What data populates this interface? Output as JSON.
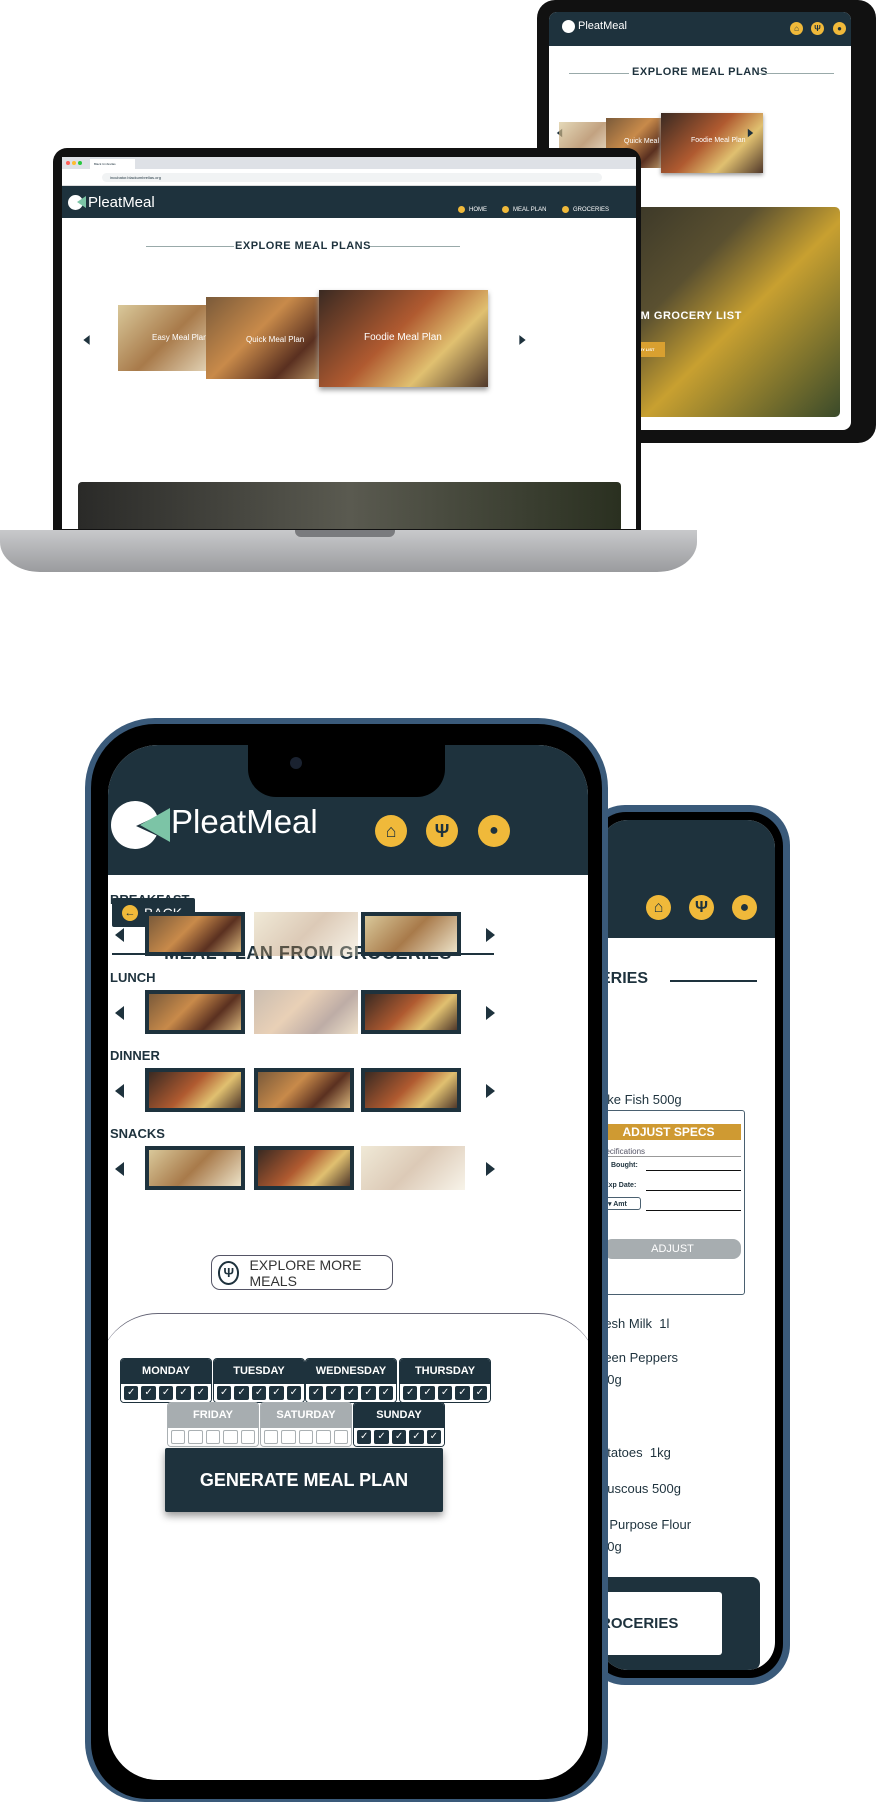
{
  "brand": "PleatMeal",
  "colors": {
    "dark": "#1e323d",
    "gold": "#f0b93a",
    "mint": "#7cc4a6"
  },
  "browser": {
    "tab": "Black Umbrellas",
    "url": "incubator.blackumbrellas.org"
  },
  "laptop": {
    "nav": [
      "HOME",
      "MEAL PLAN",
      "GROCERIES"
    ],
    "title": "EXPLORE MEAL PLANS",
    "plans": [
      "Easy Meal Plan",
      "Quick Meal Plan",
      "Foodie Meal Plan"
    ]
  },
  "tablet": {
    "title": "EXPLORE MEAL PLANS",
    "plans": [
      "Easy Meal Plan",
      "Quick Meal Plan",
      "Foodie Meal Plan"
    ],
    "banner": "E MEALS FROM GROCERY LIST",
    "banner_button": "EXPLORE FROM GROCERY LIST"
  },
  "phone_back": {
    "title_partial": "ERIES",
    "items": [
      "ake Fish 500g",
      "resh Milk  1l",
      "reen Peppers",
      "00g",
      "otatoes  1kg",
      "ouscous 500g",
      "ll Purpose Flour",
      "50g"
    ],
    "popup": {
      "title": "ADJUST SPECS",
      "subtitle": "pecifications",
      "fields": [
        "Bought:",
        "Exp Date:",
        "Amt"
      ],
      "button": "ADJUST"
    },
    "bottom_button": "ROCERIES"
  },
  "phone": {
    "back": "BACK",
    "title": "MEAL PLAN FROM GROCERIES",
    "sections": [
      "BREAKFAST",
      "LUNCH",
      "DINNER",
      "SNACKS"
    ],
    "explore_more": "EXPLORE MORE MEALS",
    "days": [
      {
        "name": "MONDAY",
        "checked": 5
      },
      {
        "name": "TUESDAY",
        "checked": 5
      },
      {
        "name": "WEDNESDAY",
        "checked": 5
      },
      {
        "name": "THURSDAY",
        "checked": 5
      },
      {
        "name": "FRIDAY",
        "checked": 0
      },
      {
        "name": "SATURDAY",
        "checked": 0
      },
      {
        "name": "SUNDAY",
        "checked": 5
      }
    ],
    "generate": "GENERATE MEAL PLAN"
  }
}
